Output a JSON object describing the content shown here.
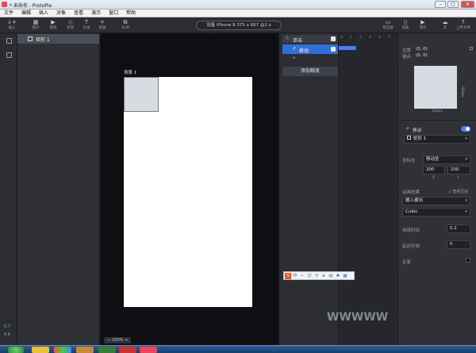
{
  "window": {
    "title": "* 未命名 - ProtoPie",
    "min": "–",
    "max": "□",
    "close": "✕"
  },
  "menu": [
    "文件",
    "编辑",
    "插入",
    "对象",
    "查看",
    "演示",
    "窗口",
    "帮助"
  ],
  "toolbar": {
    "left": [
      {
        "icon": "↓+",
        "label": "插入"
      },
      {
        "icon": "▦",
        "label": "图片"
      },
      {
        "icon": "▶",
        "label": "视频"
      },
      {
        "icon": "◇",
        "label": "形状"
      },
      {
        "icon": "T",
        "label": "文本"
      },
      {
        "icon": "⌗",
        "label": "容器"
      },
      {
        "icon": "▭",
        "label": "组件"
      },
      {
        "icon": "⧉",
        "label": "Shift"
      }
    ],
    "device_label": "设备 iPhone 8  375 x 667  @2 x",
    "right": [
      {
        "icon": "▭",
        "label": "预览器"
      },
      {
        "icon": "▯",
        "label": "设备"
      },
      {
        "icon": "▶",
        "label": "演示"
      },
      {
        "icon": "☁",
        "label": "云"
      },
      {
        "icon": "↑",
        "label": "上传文件"
      }
    ]
  },
  "layers": {
    "items": [
      {
        "label": "矩形 1"
      }
    ]
  },
  "canvas": {
    "scene_label": "场景 1",
    "zoom": "—  100%  +"
  },
  "interactions": {
    "trigger": {
      "icon": "☝",
      "label": "单击"
    },
    "response": {
      "icon": "↗",
      "label": "移动"
    },
    "add_response": "+",
    "add_trigger_button": "添加触发"
  },
  "timeline": {
    "ticks": [
      "0",
      "1",
      "2",
      "3",
      "4",
      "5",
      "6"
    ]
  },
  "inspector": {
    "position_label": "位置",
    "position_value": "(0, 0)",
    "anchor_label": "锚点",
    "anchor_value": "(0, 0)",
    "width_label": "100px",
    "height_label": "100px",
    "response_title": "移动",
    "toggle_color": "#4a7cff",
    "target": "矩形 1",
    "coord_label": "坐标位",
    "coord_mode": "移动至",
    "x_value": "200",
    "y_value": "200",
    "x_caption": "X",
    "y_caption": "Y",
    "easing_label": "动画效果",
    "easing_link": "◇ 查看区别",
    "easing_value": "缓入缓出",
    "curve_value": "Cubic",
    "duration_label": "持续时间",
    "duration_value": "0.2",
    "delay_label": "延迟开始",
    "delay_value": "0",
    "reverse_label": "反复"
  },
  "ime": [
    "S",
    "中",
    "•",
    "☺",
    "⚲",
    "≡",
    "▤",
    "♣",
    "▦"
  ],
  "status": {
    "version": "0.7",
    "build": "0.6"
  },
  "watermark": "WWWWW"
}
